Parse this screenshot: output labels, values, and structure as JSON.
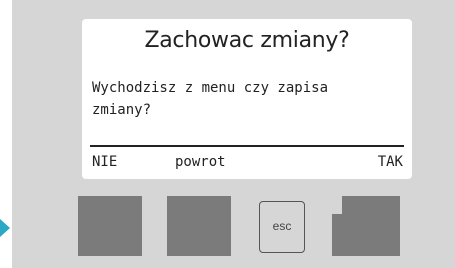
{
  "dialog": {
    "title": "Zachowac zmiany?",
    "message_line1": "Wychodzisz z menu czy zapisa",
    "message_line2": "zmiany?"
  },
  "softkeys": {
    "left_label": "NIE",
    "middle_label": "powrot",
    "right_label": "TAK"
  },
  "hardware_buttons": {
    "esc_label": "esc"
  },
  "colors": {
    "panel": "#d6d6d6",
    "button": "#7b7b7b",
    "marker": "#2ba8c3"
  }
}
